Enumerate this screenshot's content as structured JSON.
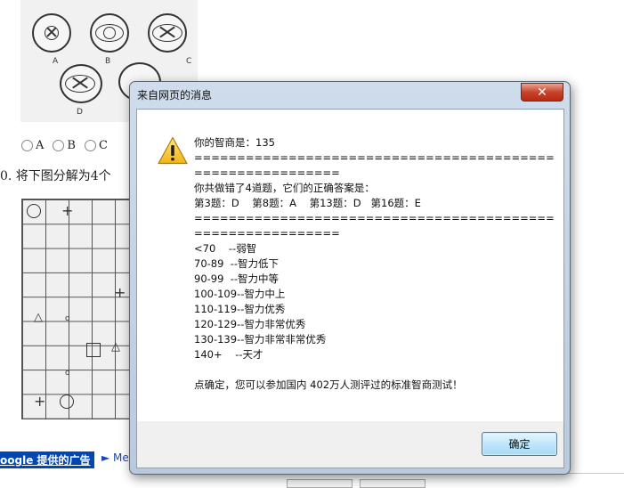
{
  "background_page": {
    "figure_labels": [
      "A",
      "B",
      "C",
      "D"
    ],
    "options": [
      "A",
      "B",
      "C"
    ],
    "question_text": "0.  将下图分解为4个",
    "ad_link": "oogle 提供的广告",
    "more_link": "► Me"
  },
  "dialog": {
    "title": "来自网页的消息",
    "close_icon": "close-icon",
    "message_lines": [
      "你的智商是：135",
      "===========================================================",
      "你共做错了4道题，它们的正确答案是：",
      "第3题：D    第8题：A    第13题：D   第16题：E",
      "===========================================================",
      "<70    --弱智",
      "70-89  --智力低下",
      "90-99  --智力中等",
      "100-109--智力中上",
      "110-119--智力优秀",
      "120-129--智力非常优秀",
      "130-139--智力非常非常优秀",
      "140+    --天才",
      "",
      "点确定，您可以参加国内 402万人测评过的标准智商测试！"
    ],
    "ok_label": "确定",
    "icon": "warning-icon"
  },
  "colors": {
    "ok_border": "#3c7fb1",
    "close_red": "#c8432a",
    "ad_blue": "#0047b3"
  }
}
